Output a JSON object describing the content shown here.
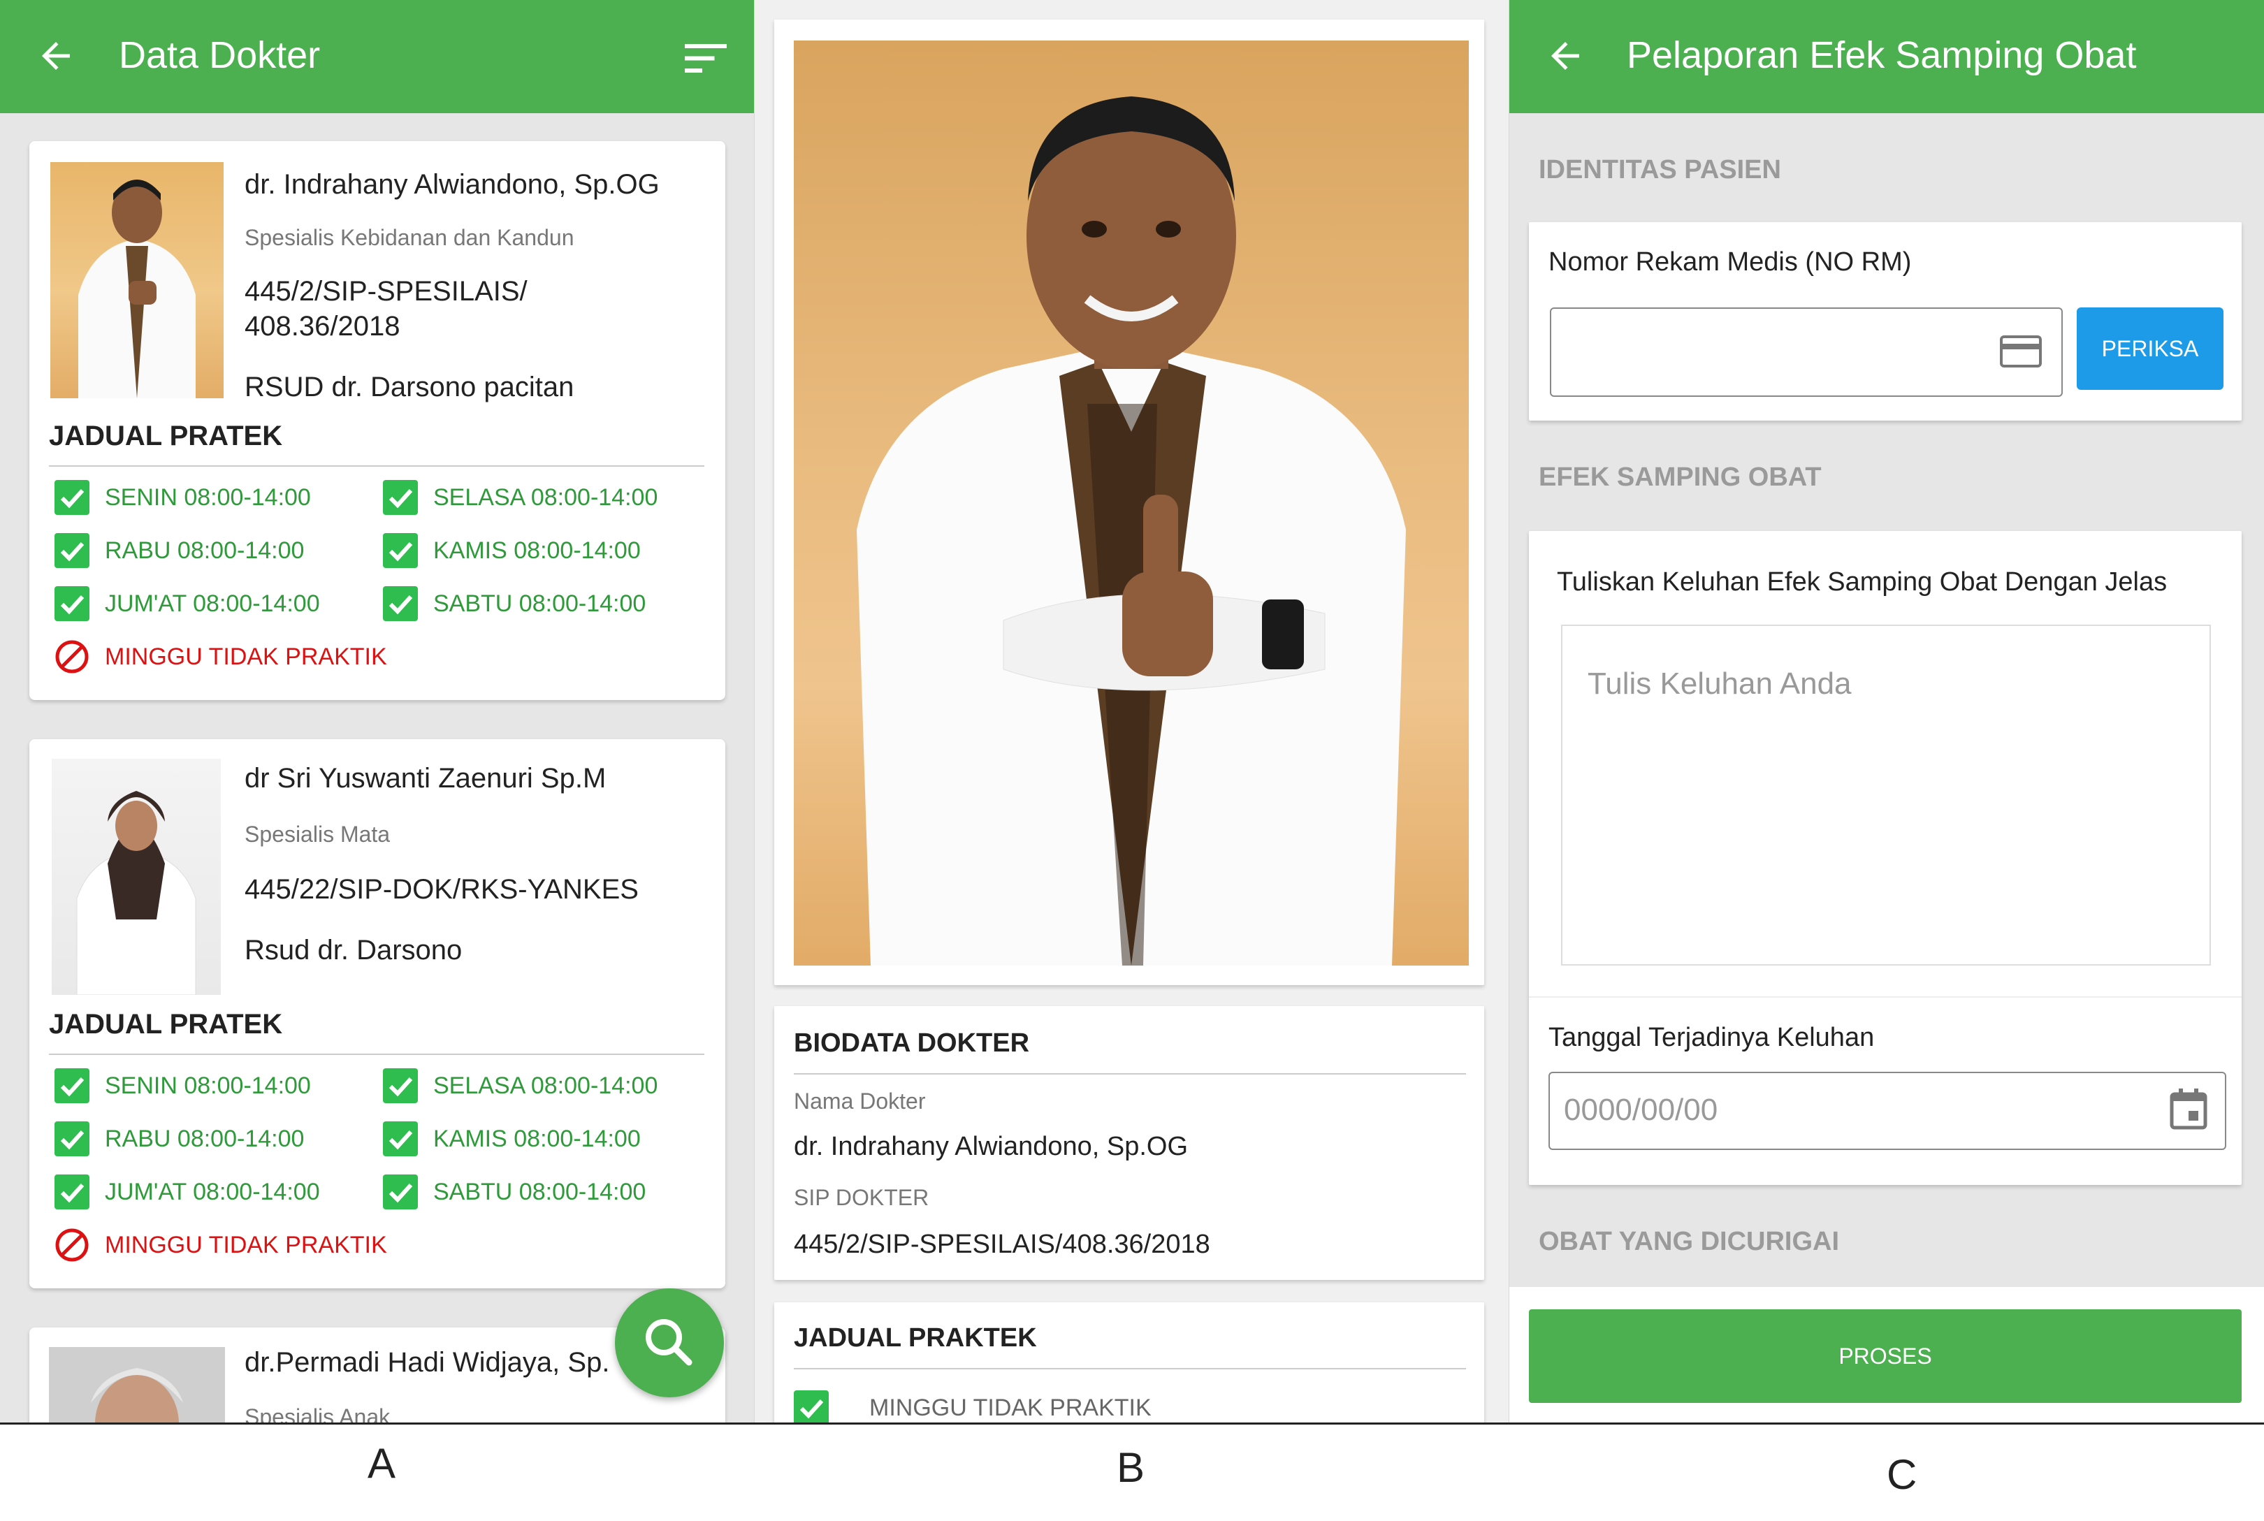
{
  "panel_a": {
    "title": "Data Dokter",
    "doctors": [
      {
        "name": "dr. Indrahany Alwiandono, Sp.OG",
        "specialty": "Spesialis Kebidanan dan Kandun",
        "sip": "445/2/SIP-SPESILAIS/ 408.36/2018",
        "hospital": "RSUD dr. Darsono pacitan",
        "schedule_title": "JADUAL PRATEK",
        "schedule": [
          "SENIN 08:00-14:00",
          "SELASA 08:00-14:00",
          "RABU 08:00-14:00",
          "KAMIS 08:00-14:00",
          "JUM'AT 08:00-14:00",
          "SABTU  08:00-14:00"
        ],
        "closed": "MINGGU TIDAK PRAKTIK"
      },
      {
        "name": "dr Sri Yuswanti Zaenuri Sp.M",
        "specialty": "Spesialis Mata",
        "sip": "445/22/SIP-DOK/RKS-YANKES",
        "hospital": "Rsud dr. Darsono",
        "schedule_title": "JADUAL PRATEK",
        "schedule": [
          "SENIN 08:00-14:00",
          "SELASA 08:00-14:00",
          "RABU 08:00-14:00",
          "KAMIS 08:00-14:00",
          "JUM'AT 08:00-14:00",
          "SABTU  08:00-14:00"
        ],
        "closed": "MINGGU TIDAK PRAKTIK"
      },
      {
        "name": "dr.Permadi Hadi Widjaya, Sp.",
        "specialty": "Spesialis Anak"
      }
    ],
    "label": "A"
  },
  "panel_b": {
    "biodata_title": "BIODATA DOKTER",
    "name_label": "Nama Dokter",
    "name_value": "dr. Indrahany Alwiandono, Sp.OG",
    "sip_label": "SIP DOKTER",
    "sip_value": "445/2/SIP-SPESILAIS/408.36/2018",
    "schedule_title": "JADUAL PRAKTEK",
    "schedule_first": "MINGGU TIDAK PRAKTIK",
    "label": "B"
  },
  "panel_c": {
    "title": "Pelaporan Efek Samping Obat",
    "section_identitas": "IDENTITAS PASIEN",
    "rm_label": "Nomor Rekam Medis (NO RM)",
    "rm_value": "",
    "periksa_label": "PERIKSA",
    "section_efek": "EFEK SAMPING OBAT",
    "keluhan_label": "Tuliskan Keluhan Efek Samping Obat Dengan Jelas",
    "keluhan_placeholder": "Tulis Keluhan Anda",
    "tanggal_label": "Tanggal Terjadinya Keluhan",
    "tanggal_placeholder": "0000/00/00",
    "section_obat": "OBAT YANG DICURIGAI",
    "proses_label": "PROSES",
    "label": "C"
  },
  "colors": {
    "primary_green": "#4caf50",
    "check_green": "#2ebd4e",
    "closed_red": "#d11111",
    "button_blue": "#1e9be8"
  }
}
